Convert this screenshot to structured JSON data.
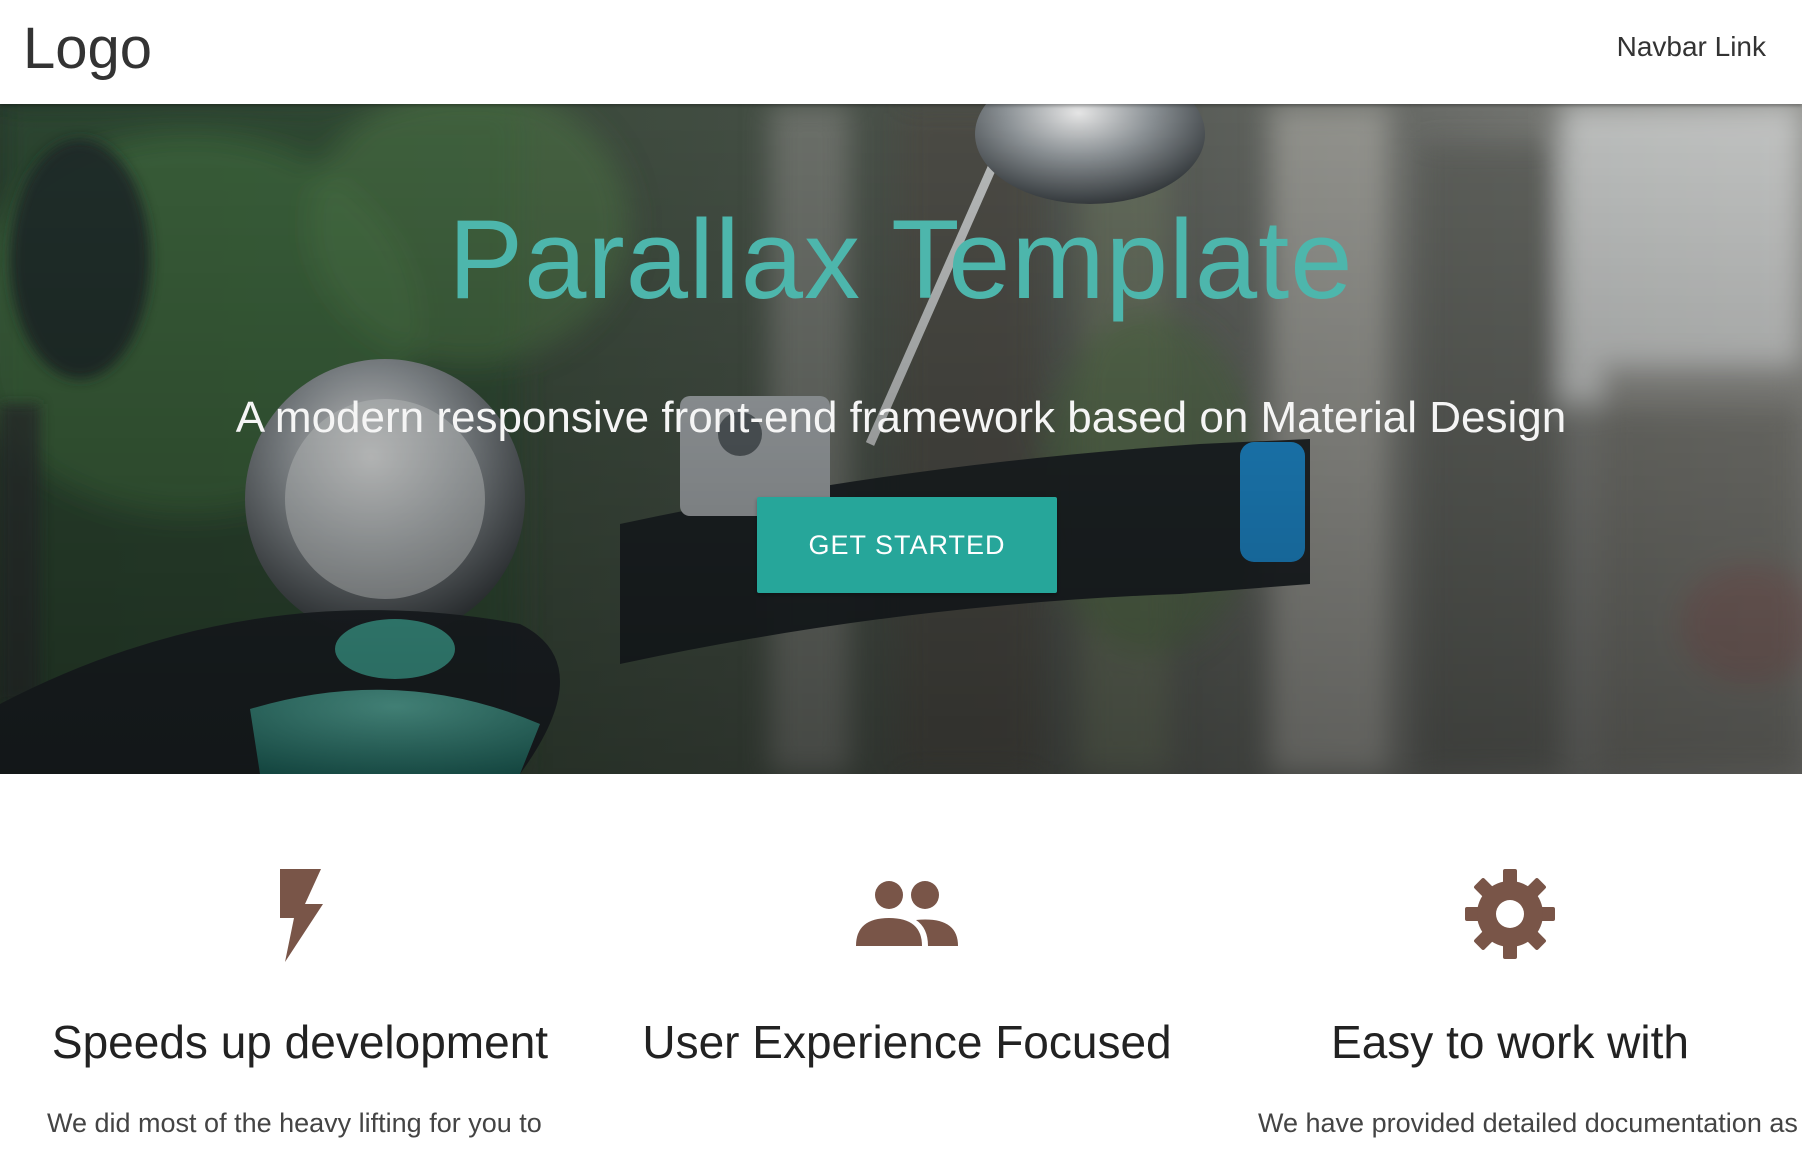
{
  "navbar": {
    "logo": "Logo",
    "links": [
      "Navbar Link"
    ]
  },
  "hero": {
    "title": "Parallax Template",
    "subtitle": "A modern responsive front-end framework based on Material Design",
    "cta_label": "GET STARTED"
  },
  "features": [
    {
      "icon": "flash-icon",
      "title": "Speeds up development",
      "text": "We did most of the heavy lifting for you to"
    },
    {
      "icon": "group-icon",
      "title": "User Experience Focused",
      "text": ""
    },
    {
      "icon": "settings-icon",
      "title": "Easy to work with",
      "text": "We have provided detailed documentation as"
    }
  ],
  "colors": {
    "accent": "#26a69a",
    "title": "#4db6ac",
    "icon": "#795548",
    "navbar_bg": "#ffffff"
  }
}
